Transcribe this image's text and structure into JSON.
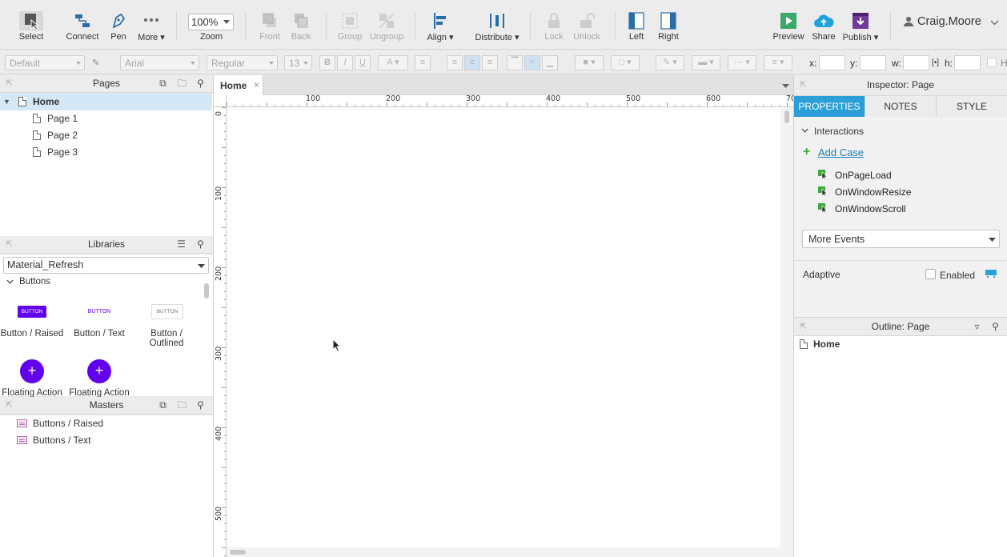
{
  "toolbar": {
    "select": "Select",
    "connect": "Connect",
    "pen": "Pen",
    "more": "More ▾",
    "zoom_value": "100%",
    "zoom_label": "Zoom",
    "front": "Front",
    "back": "Back",
    "group": "Group",
    "ungroup": "Ungroup",
    "align": "Align ▾",
    "distribute": "Distribute ▾",
    "lock": "Lock",
    "unlock": "Unlock",
    "left": "Left",
    "right": "Right",
    "preview": "Preview",
    "share": "Share",
    "publish": "Publish ▾",
    "user": "Craig.Moore"
  },
  "formatbar": {
    "style": "Default",
    "font": "Arial",
    "weight": "Regular",
    "size": "13",
    "bold": "B",
    "italic": "I",
    "underline": "U",
    "x_label": "x:",
    "y_label": "y:",
    "w_label": "w:",
    "h_label": "h:",
    "hidden_label": "H"
  },
  "pages": {
    "title": "Pages",
    "items": [
      "Home",
      "Page 1",
      "Page 2",
      "Page 3"
    ]
  },
  "libraries": {
    "title": "Libraries",
    "selected": "Material_Refresh",
    "section": "Buttons",
    "items": [
      {
        "label": "Button / Raised",
        "preview": "BUTTON"
      },
      {
        "label": "Button / Text",
        "preview": "BUTTON"
      },
      {
        "label": "Button / Outlined",
        "preview": "BUTTON"
      },
      {
        "label": "Floating Action",
        "preview": "+"
      },
      {
        "label": "Floating Action",
        "preview": "+"
      }
    ]
  },
  "masters": {
    "title": "Masters",
    "items": [
      "Buttons / Raised",
      "Buttons / Text"
    ]
  },
  "canvas": {
    "tab": "Home",
    "tab_close": "×",
    "ruler_h": [
      "100",
      "200",
      "300",
      "400",
      "500",
      "600",
      "70"
    ],
    "ruler_v": [
      "0",
      "100",
      "200",
      "300",
      "400",
      "500"
    ]
  },
  "inspector": {
    "title": "Inspector: Page",
    "tabs": [
      "PROPERTIES",
      "NOTES",
      "STYLE"
    ],
    "interactions": "Interactions",
    "add_case": "Add Case",
    "events": [
      "OnPageLoad",
      "OnWindowResize",
      "OnWindowScroll"
    ],
    "more_events": "More Events",
    "adaptive": "Adaptive",
    "enabled": "Enabled"
  },
  "outline": {
    "title": "Outline: Page",
    "root": "Home"
  },
  "colors": {
    "accent": "#2a9fd8",
    "material": "#6200ee",
    "preview_green": "#3aaa6b",
    "share_blue": "#1fa2e0",
    "publish_purple": "#6e3c97"
  }
}
